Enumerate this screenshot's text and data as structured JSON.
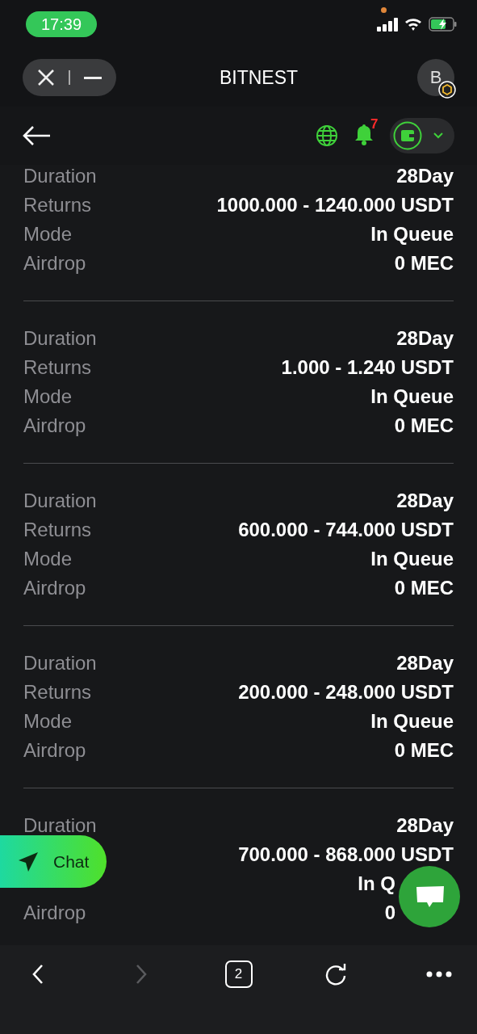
{
  "status_bar": {
    "time": "17:39"
  },
  "mini_app": {
    "title": "BITNEST",
    "avatar": "B"
  },
  "nav": {
    "notifications": "7"
  },
  "orders": [
    {
      "rows": [
        {
          "label": "Duration",
          "value": "28Day"
        },
        {
          "label": "Returns",
          "value": "1000.000 - 1240.000 USDT"
        },
        {
          "label": "Mode",
          "value": "In Queue"
        },
        {
          "label": "Airdrop",
          "value": "0 MEC"
        }
      ]
    },
    {
      "rows": [
        {
          "label": "Duration",
          "value": "28Day"
        },
        {
          "label": "Returns",
          "value": "1.000 - 1.240 USDT"
        },
        {
          "label": "Mode",
          "value": "In Queue"
        },
        {
          "label": "Airdrop",
          "value": "0 MEC"
        }
      ]
    },
    {
      "rows": [
        {
          "label": "Duration",
          "value": "28Day"
        },
        {
          "label": "Returns",
          "value": "600.000 - 744.000 USDT"
        },
        {
          "label": "Mode",
          "value": "In Queue"
        },
        {
          "label": "Airdrop",
          "value": "0 MEC"
        }
      ]
    },
    {
      "rows": [
        {
          "label": "Duration",
          "value": "28Day"
        },
        {
          "label": "Returns",
          "value": "200.000 - 248.000 USDT"
        },
        {
          "label": "Mode",
          "value": "In Queue"
        },
        {
          "label": "Airdrop",
          "value": "0 MEC"
        }
      ]
    },
    {
      "rows": [
        {
          "label": "Duration",
          "value": "28Day"
        },
        {
          "value": "700.000 - 868.000 USDT"
        },
        {
          "value": "In Q"
        },
        {
          "label": "Airdrop",
          "value": "0"
        }
      ]
    }
  ],
  "chat_button": {
    "label": "Chat"
  },
  "browser_bar": {
    "tabs": "2",
    "forward_disabled": true
  }
}
